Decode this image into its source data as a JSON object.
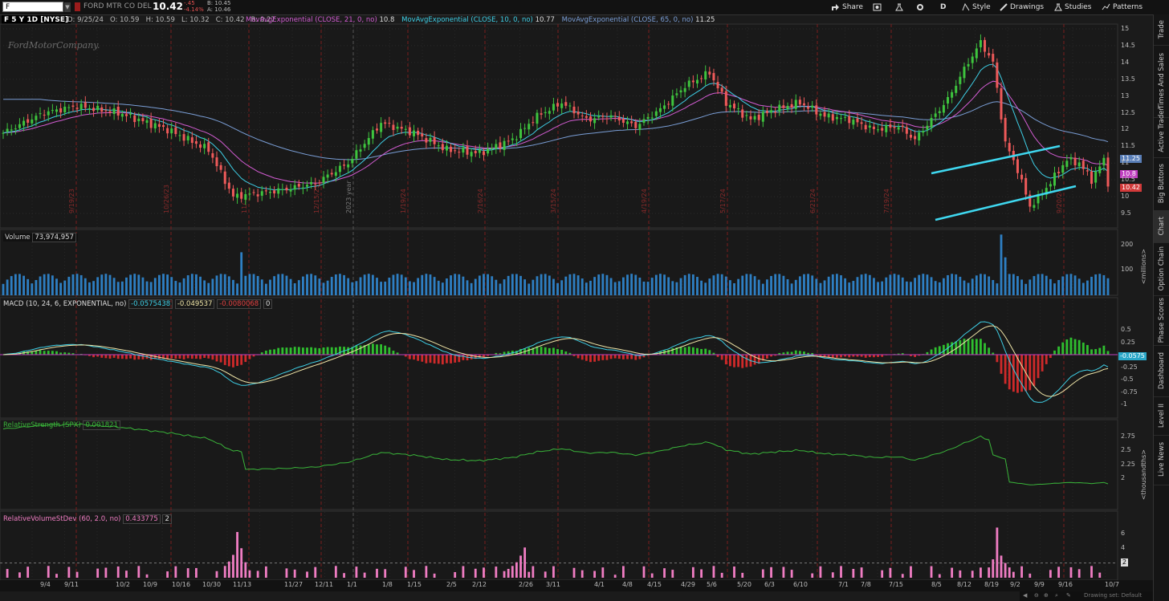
{
  "topbar": {
    "symbol": "F",
    "company": "FORD MTR CO DEL",
    "last": "10.42",
    "chg_abs": "-.45",
    "chg_pct": "-4.14%",
    "bid": "B: 10.45",
    "ask": "A: 10.46",
    "buttons": {
      "share": "Share",
      "interval": "D",
      "style": "Style",
      "drawings": "Drawings",
      "studies": "Studies",
      "patterns": "Patterns"
    }
  },
  "price_header": {
    "chart_label": "F 5 Y 1D [NYSE]",
    "date": "D: 9/25/24",
    "open": "O: 10.59",
    "high": "H: 10.59",
    "low": "L: 10.32",
    "close": "C: 10.42",
    "range": "R: 0.27",
    "ema1": "MovAvgExponential (CLOSE, 21, 0, no)",
    "ema1_val": "10.8",
    "ema2": "MovAvgExponential (CLOSE, 10, 0, no)",
    "ema2_val": "10.77",
    "ema3": "MovAvgExponential (CLOSE, 65, 0, no)",
    "ema3_val": "11.25"
  },
  "watermark": "FordMotorCompany.",
  "price_axis": [
    "15",
    "14.5",
    "14",
    "13.5",
    "13",
    "12.5",
    "12",
    "11.5",
    "11",
    "10.5",
    "10",
    "9.5"
  ],
  "price_tags": {
    "ema65": "11.25",
    "ema21": "10.8",
    "last": "10.42"
  },
  "colors": {
    "up": "#3ec43e",
    "down": "#ef5a5a",
    "ema10": "#3ecfe6",
    "ema21": "#d25cd2",
    "ema65": "#7a9ed6",
    "channel": "#3fd8f0",
    "volume": "#2e7fc3",
    "signal": "#f0e6a8",
    "rs": "#3ab53a",
    "rvs": "#f07dc3"
  },
  "event_labels": [
    {
      "t": "9/19/23"
    },
    {
      "t": "10/26/23"
    },
    {
      "t": "11/..."
    },
    {
      "t": "12/15/23"
    },
    {
      "t": "2023 year"
    },
    {
      "t": "1/19/24"
    },
    {
      "t": "2/16/24"
    },
    {
      "t": "3/15/24"
    },
    {
      "t": "4/19/24"
    },
    {
      "t": "5/17/24"
    },
    {
      "t": "6/21/24"
    },
    {
      "t": "7/19/24"
    },
    {
      "t": "9/20/24"
    }
  ],
  "volume": {
    "label": "Volume",
    "value": "73,974,957",
    "axis": [
      "200",
      "100"
    ],
    "unit": "<millions>"
  },
  "macd": {
    "label": "MACD (10, 24, 6, EXPONENTIAL, no)",
    "v1": "-0.0575438",
    "v2": "-0.049537",
    "v3": "-0.0080068",
    "v4": "0",
    "axis": [
      "0.5",
      "0.25",
      "-0.25",
      "-0.5",
      "-0.75",
      "-1"
    ],
    "tag": "-0.0575"
  },
  "rs": {
    "label": "RelativeStrength (SPX)",
    "value": "0.001821",
    "axis": [
      "2.75",
      "2.5",
      "2.25",
      "2"
    ],
    "unit": "<thousandths>"
  },
  "rvs": {
    "label": "RelativeVolumeStDev (60, 2.0, no)",
    "value": "0.433775",
    "v2": "2",
    "axis": [
      "6",
      "4",
      "2"
    ],
    "tag": "2"
  },
  "dates": [
    "9/4",
    "9/11",
    "10/2",
    "10/9",
    "10/16",
    "10/30",
    "11/13",
    "11/27",
    "12/11",
    "1/1",
    "1/8",
    "1/15",
    "2/5",
    "2/12",
    "2/26",
    "3/11",
    "4/1",
    "4/8",
    "4/15",
    "4/29",
    "5/6",
    "5/20",
    "6/3",
    "6/10",
    "7/1",
    "7/8",
    "7/15",
    "8/5",
    "8/12",
    "8/19",
    "9/2",
    "9/9",
    "9/16",
    "10/7"
  ],
  "bottom": {
    "drawing_set": "Drawing set: Default"
  },
  "sidebar": [
    "Trade",
    "Times And Sales",
    "Active Trader",
    "Big Buttons",
    "Chart",
    "Option Chain",
    "Phase Scores",
    "Dashboard",
    "Level II",
    "Live News"
  ]
}
